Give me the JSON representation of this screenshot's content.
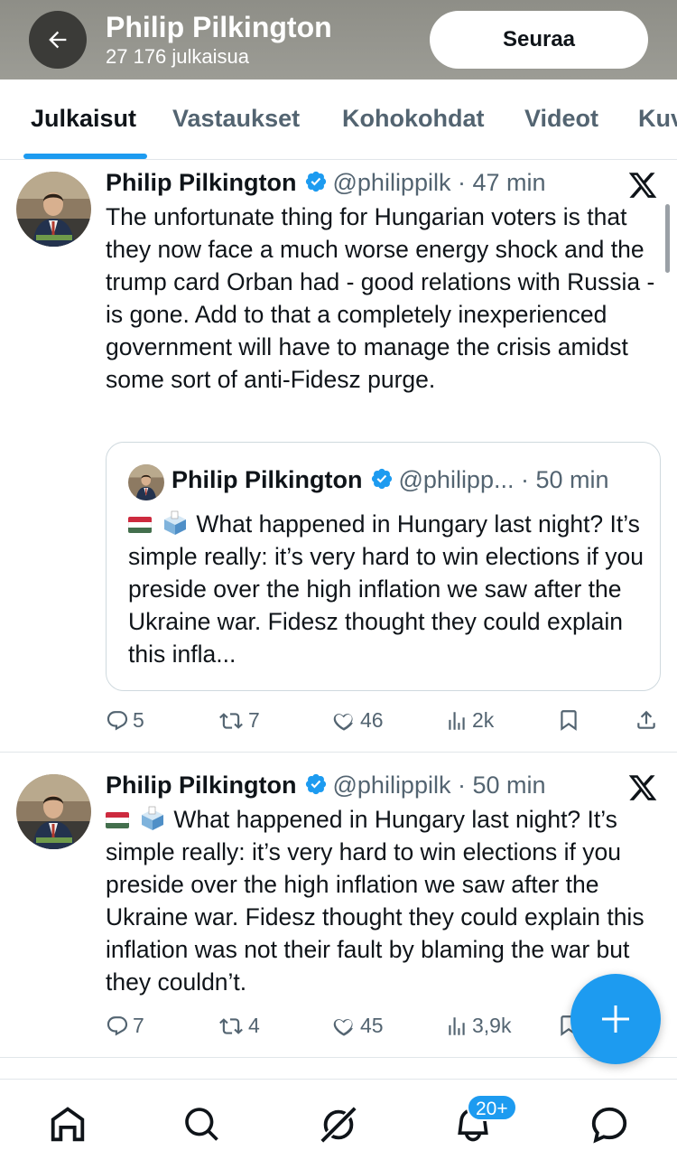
{
  "header": {
    "name": "Philip Pilkington",
    "post_count": "27 176 julkaisua",
    "follow_label": "Seuraa"
  },
  "tabs": [
    {
      "label": "Julkaisut",
      "active": true
    },
    {
      "label": "Vastaukset",
      "active": false
    },
    {
      "label": "Kohokohdat",
      "active": false
    },
    {
      "label": "Videot",
      "active": false
    },
    {
      "label": "Kuv",
      "active": false
    }
  ],
  "posts": [
    {
      "name": "Philip Pilkington",
      "handle": "@philippilk",
      "time": "· 47 min",
      "text": "The unfortunate thing for Hungarian voters is that they now face a much worse energy shock and the trump card Orban had - good relations with Russia - is gone. Add to that a completely inexperienced government will have to manage the crisis amidst some sort of anti-Fidesz purge.",
      "quote": {
        "name": "Philip Pilkington",
        "handle": "@philipp...",
        "time": "· 50 min",
        "text": "What happened in Hungary last night? It’s simple really: it’s very hard to win elections if you preside over the high inflation we saw after the Ukraine war. Fidesz thought they could explain this infla..."
      },
      "replies": "5",
      "reposts": "7",
      "likes": "46",
      "views": "2k"
    },
    {
      "name": "Philip Pilkington",
      "handle": "@philippilk",
      "time": "· 50 min",
      "text": "What happened in Hungary last night? It’s simple really: it’s very hard to win elections if you preside over the high inflation we saw after the Ukraine war. Fidesz thought they could explain this inflation was not their fault by blaming the war but they couldn’t.",
      "replies": "7",
      "reposts": "4",
      "likes": "45",
      "views": "3,9k"
    }
  ],
  "bottom_nav": {
    "notifications_badge": "20+"
  },
  "colors": {
    "accent": "#1d9bf0",
    "text_primary": "#0f1419",
    "text_secondary": "#536471",
    "header_bg": "#95958e",
    "flag_red": "#cd2a3e",
    "flag_white": "#ffffff",
    "flag_green": "#436f4d"
  },
  "icons": [
    "back-arrow-icon",
    "verified-badge-icon",
    "x-logo-icon",
    "reply-icon",
    "repost-icon",
    "like-icon",
    "views-icon",
    "bookmark-icon",
    "share-icon",
    "compose-plus-icon",
    "home-icon",
    "search-icon",
    "grok-icon",
    "notifications-bell-icon",
    "messages-icon",
    "hungary-flag-icon",
    "ballot-box-icon"
  ]
}
